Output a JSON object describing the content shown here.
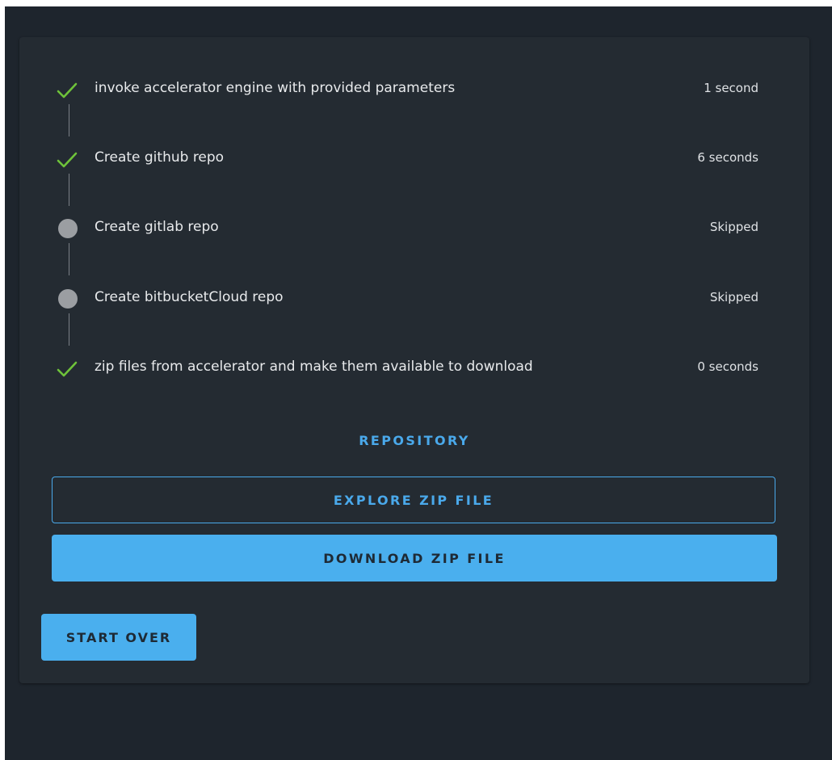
{
  "steps": [
    {
      "status": "done",
      "label": "invoke accelerator engine with provided parameters",
      "time": "1 second",
      "icon": "check-icon"
    },
    {
      "status": "done",
      "label": "Create github repo",
      "time": "6 seconds",
      "icon": "check-icon"
    },
    {
      "status": "skipped",
      "label": "Create gitlab repo",
      "time": "Skipped",
      "icon": "skipped-dot-icon"
    },
    {
      "status": "skipped",
      "label": "Create bitbucketCloud repo",
      "time": "Skipped",
      "icon": "skipped-dot-icon"
    },
    {
      "status": "done",
      "label": "zip files from accelerator and make them available to download",
      "time": "0 seconds",
      "icon": "check-icon"
    }
  ],
  "actions": {
    "repository_label": "REPOSITORY",
    "explore_label": "EXPLORE ZIP FILE",
    "download_label": "DOWNLOAD ZIP FILE",
    "start_over_label": "START OVER"
  },
  "colors": {
    "background": "#1e252d",
    "card": "#242b32",
    "accent": "#4aafee",
    "success": "#6ec23a",
    "skipped": "#9b9ea2"
  }
}
